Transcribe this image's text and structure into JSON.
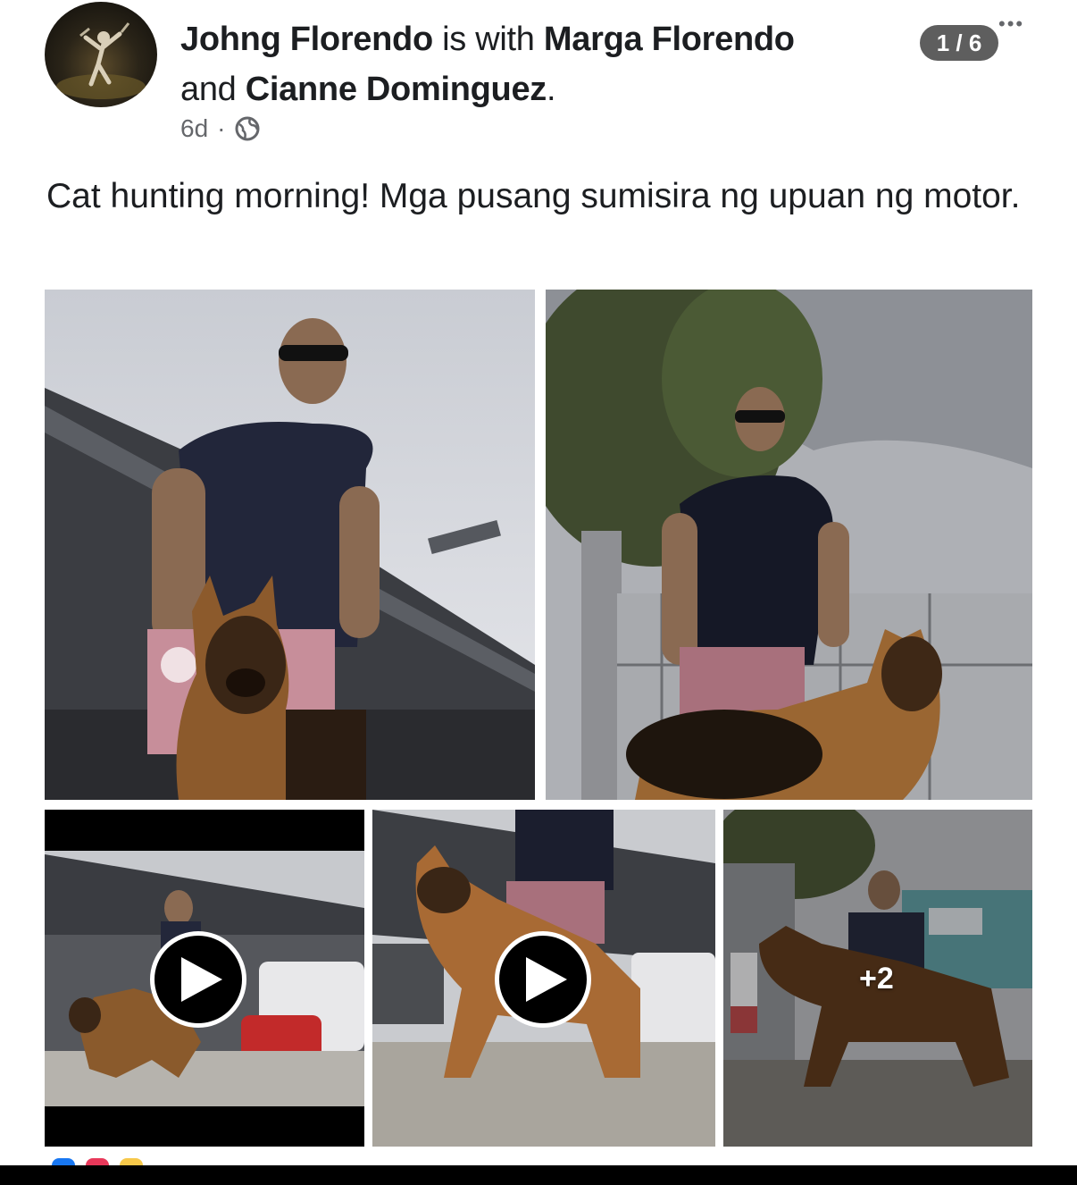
{
  "post": {
    "author": "Johng Florendo",
    "with_text": " is with ",
    "tagged_1": "Marga Florendo",
    "and_text": "and ",
    "tagged_2": "Cianne Dominguez",
    "period": ".",
    "time": "6d",
    "separator": "·",
    "privacy_icon": "globe-icon",
    "caption": "Cat hunting morning! Mga pusang sumisira ng upuan ng motor."
  },
  "viewer": {
    "counter": "1 / 6",
    "more_icon": "more-dots-icon"
  },
  "photos": {
    "extra_count": "+2",
    "play_icon": "play-icon"
  },
  "colors": {
    "text": "#1c1e21",
    "meta": "#65676b",
    "counter_bg": "#5e5e5e"
  }
}
